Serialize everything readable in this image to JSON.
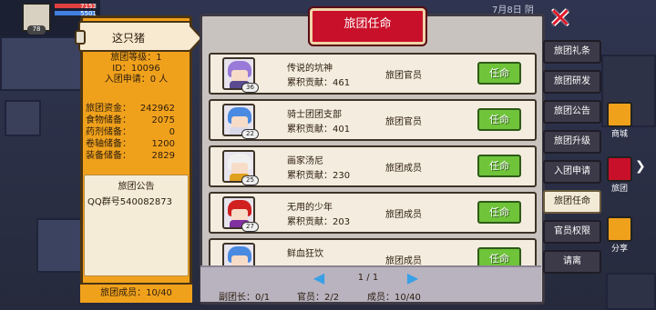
{
  "background": {
    "hud": {
      "level": "78",
      "hp": "7153",
      "mp": "5501"
    },
    "date": "7月8日 阴"
  },
  "guild_info": {
    "name": "这只猪",
    "level_label": "旅团等级：1",
    "id_label": "ID：10096",
    "applications_label": "入团申请：0 人",
    "stats": [
      {
        "label": "旅团资金：",
        "value": "242962"
      },
      {
        "label": "食物储备：",
        "value": "2075"
      },
      {
        "label": "药剂储备：",
        "value": "0"
      },
      {
        "label": "卷轴储备：",
        "value": "1200"
      },
      {
        "label": "装备储备：",
        "value": "2829"
      }
    ],
    "announcement_title": "旅团公告",
    "announcement_text": "QQ群号540082873",
    "members_label": "旅团成员：",
    "members_value": "10/40"
  },
  "main": {
    "title": "旅团任命",
    "close_icon": "close-icon",
    "appoint_label": "任命",
    "members": [
      {
        "name": "传说的坑神",
        "contribution": "累积贡献：461",
        "role": "旅团官员",
        "level": "36",
        "hair": "#9a7ad8",
        "body": "#5a4a90"
      },
      {
        "name": "骑士团团支部",
        "contribution": "累积贡献：401",
        "role": "旅团官员",
        "level": "22",
        "hair": "#4a8ae0",
        "body": "#d8d8e8"
      },
      {
        "name": "画家汤尼",
        "contribution": "累积贡献：230",
        "role": "旅团成员",
        "level": "25",
        "hair": "#f0f0f0",
        "body": "#e0a020"
      },
      {
        "name": "无用的少年",
        "contribution": "累积贡献：203",
        "role": "旅团成员",
        "level": "27",
        "hair": "#d02020",
        "body": "#8030a0"
      },
      {
        "name": "鲜血狂饮",
        "contribution": "",
        "role": "旅团成员",
        "level": "",
        "hair": "#4a8ae0",
        "body": "#d8d8e8"
      }
    ],
    "pager": {
      "text": "1 / 1"
    },
    "counts": {
      "vice": "副团长：0/1",
      "officer": "官员：2/2",
      "member": "成员：10/40"
    }
  },
  "tabs": [
    "旅团礼条",
    "旅团研发",
    "旅团公告",
    "旅团升级",
    "入团申请",
    "旅团任命",
    "官员权限",
    "请离"
  ],
  "active_tab_index": 5,
  "side_icons": [
    {
      "label": "商城",
      "color": "#f0a11c"
    },
    {
      "label": "旅团",
      "color": "#c9102a"
    },
    {
      "label": "分享",
      "color": "#f0a11c"
    }
  ]
}
